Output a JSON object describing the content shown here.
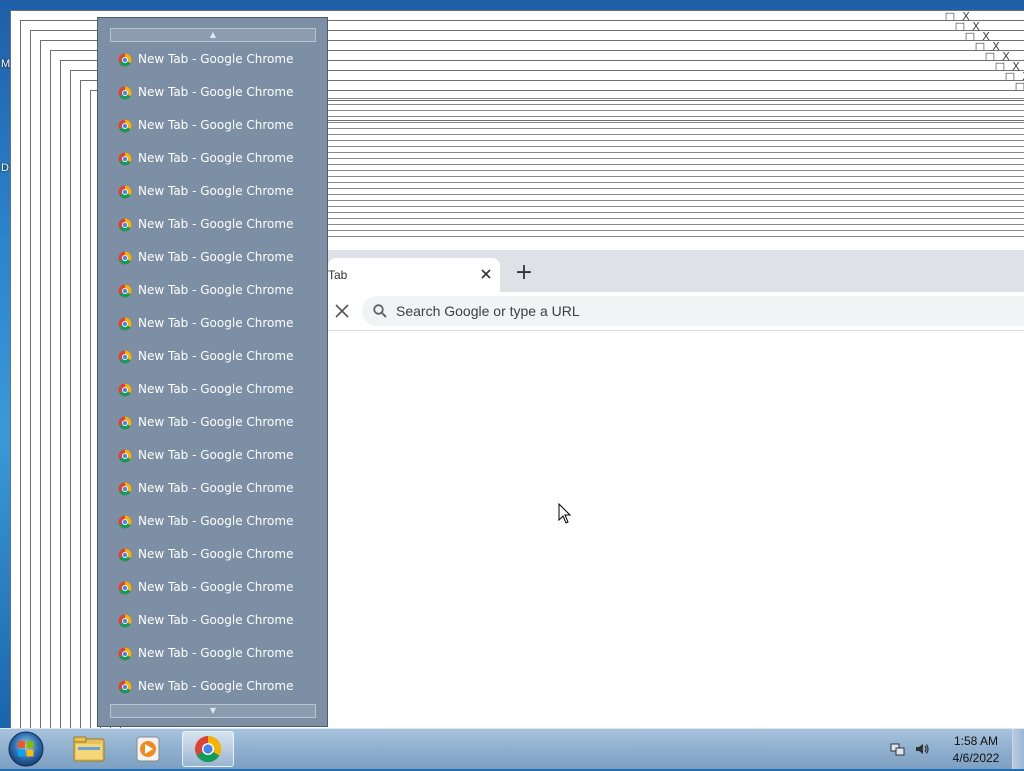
{
  "desktop": {
    "left_letters": [
      "M",
      "D"
    ]
  },
  "stacked_windows": {
    "control_glyphs": {
      "minimize": "_",
      "maximize": "□",
      "close": "X"
    }
  },
  "chrome": {
    "tab_title": "Tab",
    "tab_close_icon": "close-icon",
    "new_tab_label": "+",
    "stop_label": "✕",
    "omnibox_placeholder": "Search Google or type a URL"
  },
  "thumbnail_list": {
    "scroll_up_glyph": "▲",
    "scroll_down_glyph": "▼",
    "items": [
      {
        "label": "New Tab - Google Chrome"
      },
      {
        "label": "New Tab - Google Chrome"
      },
      {
        "label": "New Tab - Google Chrome"
      },
      {
        "label": "New Tab - Google Chrome"
      },
      {
        "label": "New Tab - Google Chrome"
      },
      {
        "label": "New Tab - Google Chrome"
      },
      {
        "label": "New Tab - Google Chrome"
      },
      {
        "label": "New Tab - Google Chrome"
      },
      {
        "label": "New Tab - Google Chrome"
      },
      {
        "label": "New Tab - Google Chrome"
      },
      {
        "label": "New Tab - Google Chrome"
      },
      {
        "label": "New Tab - Google Chrome"
      },
      {
        "label": "New Tab - Google Chrome"
      },
      {
        "label": "New Tab - Google Chrome"
      },
      {
        "label": "New Tab - Google Chrome"
      },
      {
        "label": "New Tab - Google Chrome"
      },
      {
        "label": "New Tab - Google Chrome"
      },
      {
        "label": "New Tab - Google Chrome"
      },
      {
        "label": "New Tab - Google Chrome"
      },
      {
        "label": "New Tab - Google Chrome"
      }
    ]
  },
  "taskbar": {
    "pinned": [
      "windows-explorer",
      "media-center",
      "google-chrome"
    ],
    "active": "google-chrome",
    "clock": {
      "time": "1:58 AM",
      "date": "4/6/2022"
    }
  },
  "colors": {
    "thumb_list_bg": "#7d8fa5",
    "chrome_tabstrip": "#dee1e6",
    "omnibox_bg": "#f1f3f4",
    "taskbar": "#8fb0cf"
  }
}
